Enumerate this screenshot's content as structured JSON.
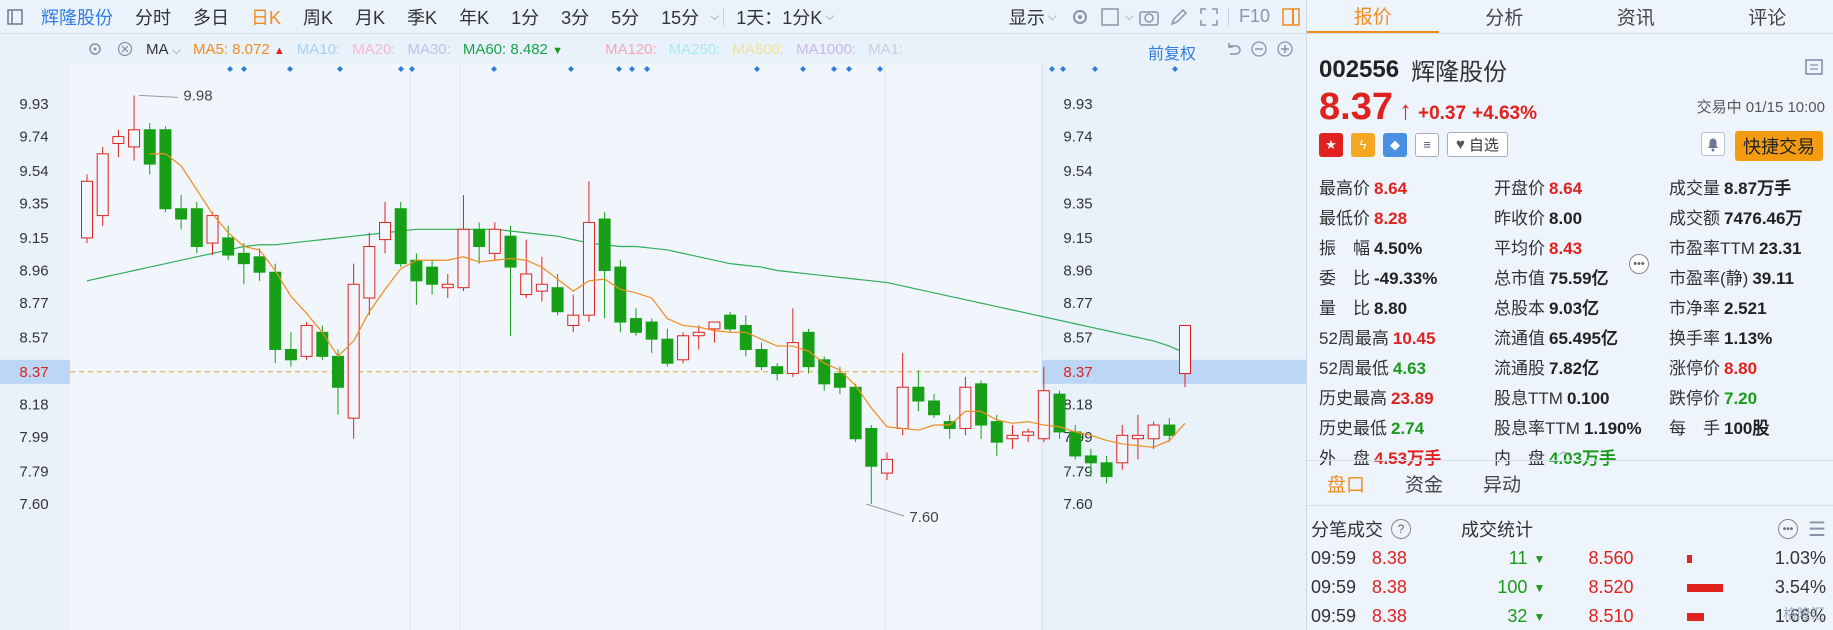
{
  "toolbar": {
    "name": "辉隆股份",
    "periods": [
      "分时",
      "多日",
      "日K",
      "周K",
      "月K",
      "季K",
      "年K",
      "1分",
      "3分",
      "5分",
      "15分"
    ],
    "active_period": "日K",
    "range_select": "1天：1分K",
    "display_select": "显示",
    "f10": "F10"
  },
  "ma_row": {
    "ma_label": "MA",
    "ma5": "MA5: 8.072",
    "ma10": "MA10:",
    "ma20": "MA20:",
    "ma30": "MA30:",
    "ma60": "MA60: 8.482",
    "ma120": "MA120:",
    "ma250": "MA250:",
    "ma500": "MA500:",
    "ma1000": "MA1000:",
    "ma_extra": "MA1:",
    "adjust": "前复权"
  },
  "chart_data": {
    "type": "candlestick",
    "y_ticks": [
      "9.93",
      "9.74",
      "9.54",
      "9.35",
      "9.15",
      "8.96",
      "8.77",
      "8.57",
      "8.37",
      "8.18",
      "7.99",
      "7.79",
      "7.60"
    ],
    "ylim": [
      7.5,
      10.1
    ],
    "current_price_label": "8.37",
    "high_annotation": "9.98",
    "low_annotation": "7.60",
    "candles": [
      {
        "o": 9.15,
        "h": 9.52,
        "l": 9.12,
        "c": 9.48
      },
      {
        "o": 9.28,
        "h": 9.68,
        "l": 9.22,
        "c": 9.64
      },
      {
        "o": 9.7,
        "h": 9.78,
        "l": 9.62,
        "c": 9.74
      },
      {
        "o": 9.68,
        "h": 9.98,
        "l": 9.6,
        "c": 9.78
      },
      {
        "o": 9.78,
        "h": 9.82,
        "l": 9.52,
        "c": 9.58
      },
      {
        "o": 9.78,
        "h": 9.8,
        "l": 9.3,
        "c": 9.32
      },
      {
        "o": 9.32,
        "h": 9.4,
        "l": 9.2,
        "c": 9.26
      },
      {
        "o": 9.32,
        "h": 9.36,
        "l": 9.06,
        "c": 9.1
      },
      {
        "o": 9.12,
        "h": 9.3,
        "l": 9.05,
        "c": 9.28
      },
      {
        "o": 9.15,
        "h": 9.22,
        "l": 9.02,
        "c": 9.05
      },
      {
        "o": 9.06,
        "h": 9.12,
        "l": 8.88,
        "c": 9.0
      },
      {
        "o": 9.04,
        "h": 9.09,
        "l": 8.9,
        "c": 8.95
      },
      {
        "o": 8.95,
        "h": 9.0,
        "l": 8.42,
        "c": 8.5
      },
      {
        "o": 8.5,
        "h": 8.6,
        "l": 8.4,
        "c": 8.44
      },
      {
        "o": 8.46,
        "h": 8.66,
        "l": 8.44,
        "c": 8.64
      },
      {
        "o": 8.6,
        "h": 8.64,
        "l": 8.44,
        "c": 8.46
      },
      {
        "o": 8.46,
        "h": 8.5,
        "l": 8.12,
        "c": 8.28
      },
      {
        "o": 8.1,
        "h": 9.0,
        "l": 7.98,
        "c": 8.88
      },
      {
        "o": 8.8,
        "h": 9.18,
        "l": 8.7,
        "c": 9.1
      },
      {
        "o": 9.14,
        "h": 9.36,
        "l": 9.06,
        "c": 9.24
      },
      {
        "o": 9.32,
        "h": 9.36,
        "l": 8.98,
        "c": 9.0
      },
      {
        "o": 9.02,
        "h": 9.06,
        "l": 8.76,
        "c": 8.9
      },
      {
        "o": 8.98,
        "h": 9.02,
        "l": 8.82,
        "c": 8.88
      },
      {
        "o": 8.86,
        "h": 8.94,
        "l": 8.8,
        "c": 8.88
      },
      {
        "o": 8.86,
        "h": 9.4,
        "l": 8.84,
        "c": 9.2
      },
      {
        "o": 9.2,
        "h": 9.24,
        "l": 9.0,
        "c": 9.1
      },
      {
        "o": 9.06,
        "h": 9.24,
        "l": 9.02,
        "c": 9.2
      },
      {
        "o": 9.16,
        "h": 9.22,
        "l": 8.58,
        "c": 8.98
      },
      {
        "o": 8.82,
        "h": 9.14,
        "l": 8.8,
        "c": 8.94
      },
      {
        "o": 8.84,
        "h": 9.04,
        "l": 8.78,
        "c": 8.88
      },
      {
        "o": 8.86,
        "h": 8.94,
        "l": 8.7,
        "c": 8.72
      },
      {
        "o": 8.64,
        "h": 8.82,
        "l": 8.6,
        "c": 8.7
      },
      {
        "o": 8.7,
        "h": 9.48,
        "l": 8.66,
        "c": 9.24
      },
      {
        "o": 9.26,
        "h": 9.3,
        "l": 8.68,
        "c": 8.96
      },
      {
        "o": 8.98,
        "h": 9.02,
        "l": 8.6,
        "c": 8.66
      },
      {
        "o": 8.68,
        "h": 8.74,
        "l": 8.58,
        "c": 8.6
      },
      {
        "o": 8.66,
        "h": 8.68,
        "l": 8.48,
        "c": 8.56
      },
      {
        "o": 8.56,
        "h": 8.62,
        "l": 8.4,
        "c": 8.42
      },
      {
        "o": 8.44,
        "h": 8.6,
        "l": 8.42,
        "c": 8.58
      },
      {
        "o": 8.58,
        "h": 8.64,
        "l": 8.5,
        "c": 8.6
      },
      {
        "o": 8.62,
        "h": 8.66,
        "l": 8.54,
        "c": 8.66
      },
      {
        "o": 8.7,
        "h": 8.72,
        "l": 8.6,
        "c": 8.62
      },
      {
        "o": 8.64,
        "h": 8.7,
        "l": 8.46,
        "c": 8.5
      },
      {
        "o": 8.5,
        "h": 8.54,
        "l": 8.38,
        "c": 8.4
      },
      {
        "o": 8.4,
        "h": 8.42,
        "l": 8.32,
        "c": 8.36
      },
      {
        "o": 8.36,
        "h": 8.74,
        "l": 8.34,
        "c": 8.54
      },
      {
        "o": 8.6,
        "h": 8.62,
        "l": 8.36,
        "c": 8.4
      },
      {
        "o": 8.44,
        "h": 8.46,
        "l": 8.26,
        "c": 8.3
      },
      {
        "o": 8.36,
        "h": 8.4,
        "l": 8.24,
        "c": 8.28
      },
      {
        "o": 8.28,
        "h": 8.3,
        "l": 7.96,
        "c": 7.98
      },
      {
        "o": 8.04,
        "h": 8.06,
        "l": 7.6,
        "c": 7.82
      },
      {
        "o": 7.78,
        "h": 7.9,
        "l": 7.74,
        "c": 7.86
      },
      {
        "o": 8.04,
        "h": 8.48,
        "l": 8.0,
        "c": 8.28
      },
      {
        "o": 8.28,
        "h": 8.38,
        "l": 8.14,
        "c": 8.2
      },
      {
        "o": 8.2,
        "h": 8.24,
        "l": 8.1,
        "c": 8.12
      },
      {
        "o": 8.08,
        "h": 8.12,
        "l": 7.98,
        "c": 8.04
      },
      {
        "o": 8.04,
        "h": 8.34,
        "l": 8.0,
        "c": 8.28
      },
      {
        "o": 8.3,
        "h": 8.32,
        "l": 7.98,
        "c": 8.06
      },
      {
        "o": 8.08,
        "h": 8.12,
        "l": 7.88,
        "c": 7.96
      },
      {
        "o": 7.98,
        "h": 8.06,
        "l": 7.92,
        "c": 8.0
      },
      {
        "o": 8.0,
        "h": 8.04,
        "l": 7.96,
        "c": 8.02
      },
      {
        "o": 7.98,
        "h": 8.4,
        "l": 7.96,
        "c": 8.26
      },
      {
        "o": 8.24,
        "h": 8.26,
        "l": 7.98,
        "c": 8.02
      },
      {
        "o": 8.02,
        "h": 8.06,
        "l": 7.86,
        "c": 7.88
      },
      {
        "o": 7.88,
        "h": 7.92,
        "l": 7.76,
        "c": 7.84
      },
      {
        "o": 7.84,
        "h": 7.88,
        "l": 7.72,
        "c": 7.76
      },
      {
        "o": 7.84,
        "h": 8.06,
        "l": 7.8,
        "c": 8.0
      },
      {
        "o": 7.98,
        "h": 8.12,
        "l": 7.86,
        "c": 8.0
      },
      {
        "o": 7.98,
        "h": 8.08,
        "l": 7.92,
        "c": 8.06
      },
      {
        "o": 8.06,
        "h": 8.1,
        "l": 7.96,
        "c": 8.0
      },
      {
        "o": 8.36,
        "h": 8.64,
        "l": 8.28,
        "c": 8.64
      }
    ],
    "ma5": [
      null,
      null,
      null,
      null,
      9.64,
      9.64,
      9.57,
      9.43,
      9.29,
      9.18,
      9.1,
      9.08,
      8.96,
      8.81,
      8.71,
      8.6,
      8.46,
      8.55,
      8.72,
      8.85,
      8.97,
      9.02,
      9.02,
      9.02,
      9.04,
      9.01,
      9.02,
      9.03,
      9.02,
      8.98,
      8.91,
      8.84,
      8.9,
      8.91,
      8.85,
      8.83,
      8.8,
      8.68,
      8.64,
      8.63,
      8.61,
      8.6,
      8.6,
      8.56,
      8.52,
      8.52,
      8.49,
      8.42,
      8.38,
      8.29,
      8.16,
      8.05,
      8.04,
      8.03,
      8.06,
      8.06,
      8.14,
      8.14,
      8.09,
      8.07,
      8.08,
      8.06,
      8.05,
      8.02,
      8.0,
      7.97,
      7.95,
      7.94,
      7.93,
      7.97,
      8.07
    ],
    "ma60": [
      8.9,
      8.92,
      8.94,
      8.96,
      8.98,
      9.0,
      9.02,
      9.04,
      9.06,
      9.08,
      9.1,
      9.11,
      9.11,
      9.12,
      9.13,
      9.14,
      9.15,
      9.16,
      9.17,
      9.18,
      9.19,
      9.2,
      9.2,
      9.2,
      9.2,
      9.2,
      9.2,
      9.19,
      9.18,
      9.17,
      9.16,
      9.14,
      9.12,
      9.11,
      9.1,
      9.1,
      9.09,
      9.08,
      9.06,
      9.04,
      9.02,
      9.0,
      8.99,
      8.98,
      8.96,
      8.95,
      8.94,
      8.93,
      8.92,
      8.91,
      8.9,
      8.89,
      8.87,
      8.85,
      8.83,
      8.81,
      8.79,
      8.77,
      8.75,
      8.73,
      8.71,
      8.69,
      8.67,
      8.65,
      8.63,
      8.61,
      8.59,
      8.57,
      8.55,
      8.52,
      8.48
    ]
  },
  "right": {
    "tabs": [
      "报价",
      "分析",
      "资讯",
      "评论"
    ],
    "active_tab": "报价",
    "code": "002556",
    "name": "辉隆股份",
    "price": "8.37",
    "arrow": "↑",
    "change": "+0.37",
    "change_pct": "+4.63%",
    "trade_time": "交易中 01/15 10:00",
    "zixuan": "自选",
    "quick_trade": "快捷交易",
    "stats": [
      {
        "k": "最高价",
        "v": "8.64",
        "c": "red"
      },
      {
        "k": "开盘价",
        "v": "8.64",
        "c": "red"
      },
      {
        "k": "成交量",
        "v": "8.87万手",
        "c": "dark"
      },
      {
        "k": "最低价",
        "v": "8.28",
        "c": "red"
      },
      {
        "k": "昨收价",
        "v": "8.00",
        "c": "dark"
      },
      {
        "k": "成交额",
        "v": "7476.46万",
        "c": "dark"
      },
      {
        "k": "振　幅",
        "v": "4.50%",
        "c": "dark"
      },
      {
        "k": "平均价",
        "v": "8.43",
        "c": "red"
      },
      {
        "k": "市盈率TTM",
        "v": "23.31",
        "c": "dark"
      },
      {
        "k": "委　比",
        "v": "-49.33%",
        "c": "dark"
      },
      {
        "k": "总市值",
        "v": "75.59亿",
        "c": "dark"
      },
      {
        "k": "市盈率(静)",
        "v": "39.11",
        "c": "dark"
      },
      {
        "k": "量　比",
        "v": "8.80",
        "c": "dark"
      },
      {
        "k": "总股本",
        "v": "9.03亿",
        "c": "dark"
      },
      {
        "k": "市净率",
        "v": "2.521",
        "c": "dark"
      },
      {
        "k": "52周最高",
        "v": "10.45",
        "c": "red"
      },
      {
        "k": "流通值",
        "v": "65.495亿",
        "c": "dark"
      },
      {
        "k": "换手率",
        "v": "1.13%",
        "c": "dark"
      },
      {
        "k": "52周最低",
        "v": "4.63",
        "c": "green"
      },
      {
        "k": "流通股",
        "v": "7.82亿",
        "c": "dark"
      },
      {
        "k": "涨停价",
        "v": "8.80",
        "c": "red"
      },
      {
        "k": "历史最高",
        "v": "23.89",
        "c": "red"
      },
      {
        "k": "股息TTM",
        "v": "0.100",
        "c": "dark"
      },
      {
        "k": "跌停价",
        "v": "7.20",
        "c": "green"
      },
      {
        "k": "历史最低",
        "v": "2.74",
        "c": "green"
      },
      {
        "k": "股息率TTM",
        "v": "1.190%",
        "c": "dark"
      },
      {
        "k": "每　手",
        "v": "100股",
        "c": "dark"
      },
      {
        "k": "外　盘",
        "v": "4.53万手",
        "c": "red"
      },
      {
        "k": "内　盘",
        "v": "4.03万手",
        "c": "green"
      }
    ],
    "bottom_tabs": [
      "盘口",
      "资金",
      "异动"
    ],
    "active_bottom_tab": "盘口",
    "fenbi_title": "分笔成交",
    "stats_title": "成交统计",
    "trades": [
      {
        "time": "09:59",
        "price": "8.38",
        "vol": "11"
      },
      {
        "time": "09:59",
        "price": "8.38",
        "vol": "100"
      },
      {
        "time": "09:59",
        "price": "8.38",
        "vol": "32"
      }
    ],
    "dist": [
      {
        "price": "8.560",
        "pct": "1.03%",
        "frac": 0.08
      },
      {
        "price": "8.520",
        "pct": "3.54%",
        "frac": 0.6
      },
      {
        "price": "8.510",
        "pct": "1.66%",
        "frac": 0.28
      }
    ],
    "watermark": "格隆汇"
  }
}
